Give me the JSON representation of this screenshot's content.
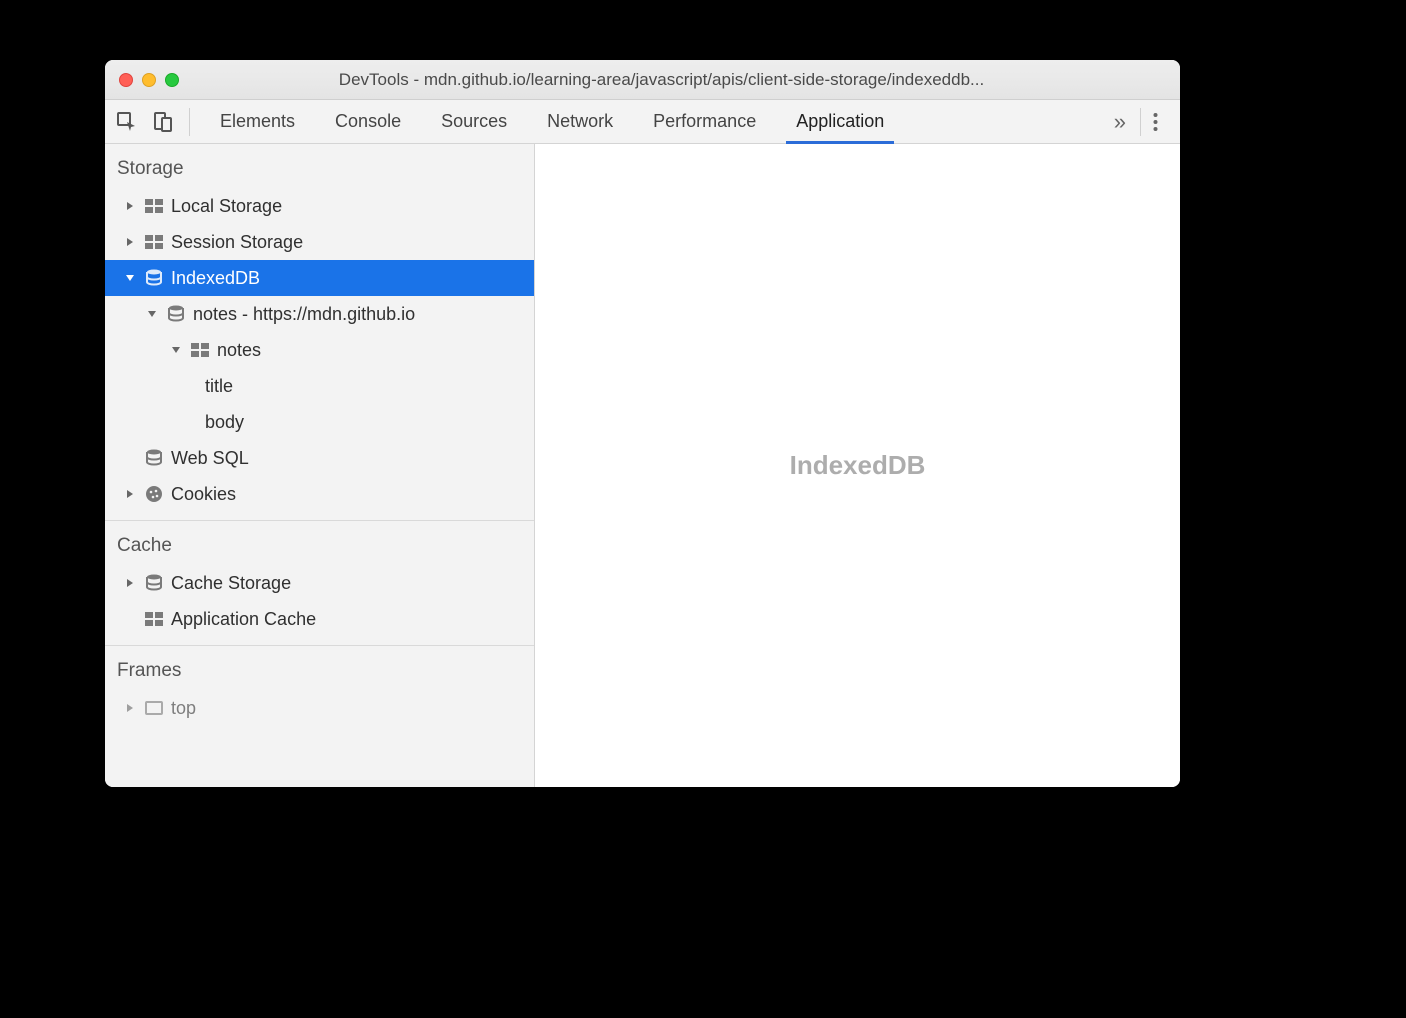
{
  "window": {
    "title": "DevTools - mdn.github.io/learning-area/javascript/apis/client-side-storage/indexeddb..."
  },
  "tabs": {
    "items": [
      {
        "label": "Elements"
      },
      {
        "label": "Console"
      },
      {
        "label": "Sources"
      },
      {
        "label": "Network"
      },
      {
        "label": "Performance"
      },
      {
        "label": "Application"
      }
    ],
    "active_index": 5,
    "overflow_glyph": "»"
  },
  "sidebar": {
    "sections": {
      "storage": {
        "title": "Storage",
        "items": {
          "local_storage": "Local Storage",
          "session_storage": "Session Storage",
          "indexeddb": "IndexedDB",
          "indexeddb_db": "notes - https://mdn.github.io",
          "indexeddb_store": "notes",
          "indexeddb_index_title": "title",
          "indexeddb_index_body": "body",
          "web_sql": "Web SQL",
          "cookies": "Cookies"
        }
      },
      "cache": {
        "title": "Cache",
        "items": {
          "cache_storage": "Cache Storage",
          "app_cache": "Application Cache"
        }
      },
      "frames": {
        "title": "Frames",
        "items": {
          "top": "top"
        }
      }
    }
  },
  "main": {
    "placeholder": "IndexedDB"
  }
}
